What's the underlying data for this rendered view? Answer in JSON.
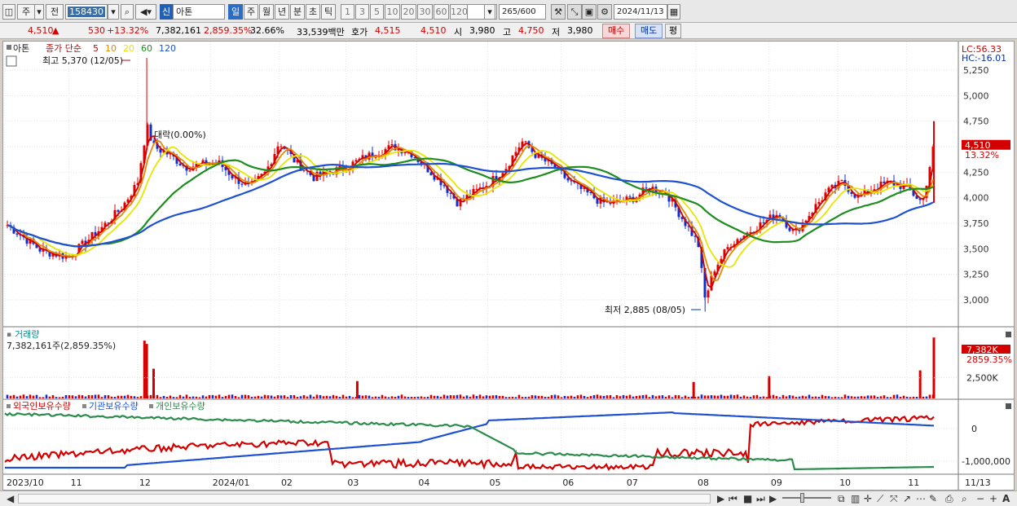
{
  "toolbar": {
    "market_label": "주",
    "prev_label": "전",
    "stock_code": "158430",
    "new_label": "신",
    "stock_name": "아톤",
    "periods": [
      "일",
      "주",
      "월",
      "년",
      "분",
      "초",
      "틱"
    ],
    "active_period": "일",
    "intervals": [
      "1",
      "3",
      "5",
      "10",
      "20",
      "30",
      "60",
      "120"
    ],
    "count_value": "265",
    "count_total": "/600",
    "date_value": "2024/11/13"
  },
  "quote": {
    "price": "4,510",
    "change": "530",
    "change_pct": "+13.32%",
    "volume": "7,382,161",
    "volume_pct": "2,859.35%",
    "turnover_pct": "32.66%",
    "amount": "33,539백만",
    "bid_label": "호가",
    "bid_value": "4,515",
    "ask_value": "4,510",
    "open_label": "시",
    "open_value": "3,980",
    "high_label": "고",
    "high_value": "4,750",
    "low_label": "저",
    "low_value": "3,980",
    "buy_label": "매수",
    "sell_label": "매도",
    "eval_label": "평"
  },
  "price_panel": {
    "stock_tag": "아톤",
    "legend_title": "종가 단순",
    "ma_periods": [
      "5",
      "10",
      "20",
      "60",
      "120"
    ],
    "ma_colors": [
      "#d40000",
      "#e58a00",
      "#e6e600",
      "#1e8c1e",
      "#1e50d2"
    ],
    "max_label": "최고 5,370 (12/05)",
    "min_label": "최저 2,885 (08/05)",
    "mid_label": "대락(0.00%)",
    "lc_label": "LC:56.33",
    "hc_label": "HC:-16.01",
    "last_price_tag": "4,510",
    "last_pct_tag": "13.32%",
    "y_ticks": [
      "5,250",
      "5,000",
      "4,750",
      "4,500",
      "4,250",
      "4,000",
      "3,750",
      "3,500",
      "3,250",
      "3,000"
    ]
  },
  "volume_panel": {
    "title": "거래량",
    "value_label": "7,382,161주(2,859.35%)",
    "last_tag": "7,382K",
    "last_pct_tag": "2859.35%",
    "y_ticks": [
      "2,500K"
    ]
  },
  "holdings_panel": {
    "legend": [
      "외국인보유수량",
      "기관보유수량",
      "개인보유수량"
    ],
    "legend_colors": [
      "#d40000",
      "#1e50d2",
      "#2a8c4a"
    ],
    "y_ticks": [
      "0",
      "-1,000,000"
    ]
  },
  "x_axis": {
    "labels": [
      "2023/10",
      "11",
      "12",
      "2024/01",
      "02",
      "03",
      "04",
      "05",
      "06",
      "07",
      "08",
      "09",
      "10",
      "11"
    ],
    "right_label": "11/13"
  },
  "chart_data": {
    "type": "line",
    "series": [
      {
        "name": "종가",
        "points": [
          [
            "2023/10/04",
            3750
          ],
          [
            "2023/10/20",
            3480
          ],
          [
            "2023/11/01",
            3420
          ],
          [
            "2023/11/15",
            3700
          ],
          [
            "2023/11/24",
            3900
          ],
          [
            "2023/12/01",
            4150
          ],
          [
            "2023/12/05",
            4700
          ],
          [
            "2023/12/08",
            4500
          ],
          [
            "2023/12/15",
            4420
          ],
          [
            "2023/12/22",
            4300
          ],
          [
            "2024/01/05",
            4350
          ],
          [
            "2024/01/12",
            4200
          ],
          [
            "2024/01/19",
            4100
          ],
          [
            "2024/01/26",
            4250
          ],
          [
            "2024/02/01",
            4550
          ],
          [
            "2024/02/08",
            4350
          ],
          [
            "2024/02/16",
            4200
          ],
          [
            "2024/02/23",
            4250
          ],
          [
            "2024/03/01",
            4300
          ],
          [
            "2024/03/08",
            4380
          ],
          [
            "2024/03/15",
            4450
          ],
          [
            "2024/03/22",
            4500
          ],
          [
            "2024/03/29",
            4450
          ],
          [
            "2024/04/05",
            4300
          ],
          [
            "2024/04/12",
            4150
          ],
          [
            "2024/04/19",
            3950
          ],
          [
            "2024/04/26",
            4050
          ],
          [
            "2024/05/03",
            4150
          ],
          [
            "2024/05/10",
            4300
          ],
          [
            "2024/05/17",
            4550
          ],
          [
            "2024/05/24",
            4400
          ],
          [
            "2024/05/31",
            4300
          ],
          [
            "2024/06/07",
            4150
          ],
          [
            "2024/06/14",
            4050
          ],
          [
            "2024/06/21",
            3950
          ],
          [
            "2024/06/28",
            3950
          ],
          [
            "2024/07/05",
            4000
          ],
          [
            "2024/07/12",
            4100
          ],
          [
            "2024/07/19",
            4050
          ],
          [
            "2024/07/26",
            3800
          ],
          [
            "2024/08/02",
            3550
          ],
          [
            "2024/08/05",
            3000
          ],
          [
            "2024/08/09",
            3300
          ],
          [
            "2024/08/16",
            3550
          ],
          [
            "2024/08/23",
            3650
          ],
          [
            "2024/08/30",
            3750
          ],
          [
            "2024/09/06",
            3850
          ],
          [
            "2024/09/13",
            3650
          ],
          [
            "2024/09/20",
            3850
          ],
          [
            "2024/09/27",
            4050
          ],
          [
            "2024/10/04",
            4150
          ],
          [
            "2024/10/11",
            4000
          ],
          [
            "2024/10/18",
            4100
          ],
          [
            "2024/10/25",
            4150
          ],
          [
            "2024/11/01",
            4100
          ],
          [
            "2024/11/08",
            3950
          ],
          [
            "2024/11/13",
            4510
          ]
        ]
      }
    ],
    "ylim": [
      2800,
      5370
    ],
    "bars_volume_highlights": [
      [
        "2023/12/04",
        7000
      ],
      [
        "2023/12/05",
        6600
      ],
      [
        "2023/12/08",
        3600
      ],
      [
        "2024/03/06",
        2100
      ],
      [
        "2024/07/31",
        2000
      ],
      [
        "2024/09/02",
        2700
      ],
      [
        "2024/11/07",
        3400
      ],
      [
        "2024/11/13",
        7382
      ]
    ],
    "grid": true,
    "legend_position": "top-left"
  }
}
